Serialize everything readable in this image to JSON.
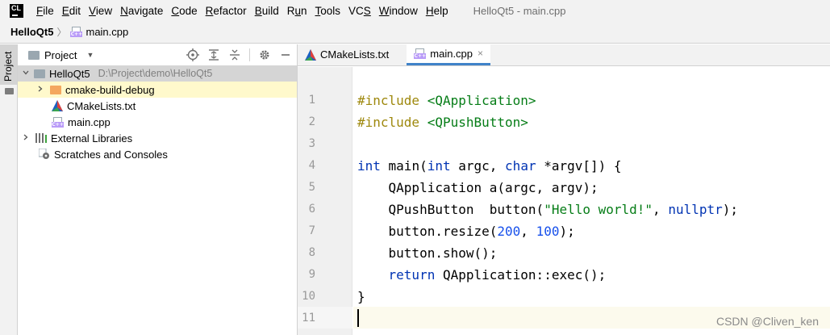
{
  "app": {
    "logo_text": "CL",
    "window_title": "HelloQt5 - main.cpp"
  },
  "menu": [
    {
      "pre": "",
      "ul": "F",
      "post": "ile"
    },
    {
      "pre": "",
      "ul": "E",
      "post": "dit"
    },
    {
      "pre": "",
      "ul": "V",
      "post": "iew"
    },
    {
      "pre": "",
      "ul": "N",
      "post": "avigate"
    },
    {
      "pre": "",
      "ul": "C",
      "post": "ode"
    },
    {
      "pre": "",
      "ul": "R",
      "post": "efactor"
    },
    {
      "pre": "",
      "ul": "B",
      "post": "uild"
    },
    {
      "pre": "R",
      "ul": "u",
      "post": "n"
    },
    {
      "pre": "",
      "ul": "T",
      "post": "ools"
    },
    {
      "pre": "VC",
      "ul": "S",
      "post": ""
    },
    {
      "pre": "",
      "ul": "W",
      "post": "indow"
    },
    {
      "pre": "",
      "ul": "H",
      "post": "elp"
    }
  ],
  "breadcrumb": {
    "project": "HelloQt5",
    "separator": "〉",
    "file": "main.cpp"
  },
  "toolstrip": {
    "project_tab": "Project"
  },
  "project_panel": {
    "title": "Project",
    "tools": {
      "locate": "target-icon",
      "expand": "expand-all-icon",
      "collapse": "collapse-all-icon",
      "settings": "gear-icon",
      "hide": "minimize-icon"
    },
    "tree": {
      "root": {
        "name": "HelloQt5",
        "path": "D:\\Project\\demo\\HelloQt5"
      },
      "build_dir": "cmake-build-debug",
      "cmakelists": "CMakeLists.txt",
      "main": "main.cpp",
      "external_libs": "External Libraries",
      "scratches": "Scratches and Consoles"
    }
  },
  "editor": {
    "tabs": [
      {
        "label": "CMakeLists.txt",
        "close": "×",
        "active": false
      },
      {
        "label": "main.cpp",
        "close": "×",
        "active": true
      }
    ],
    "line_numbers": [
      "1",
      "2",
      "3",
      "4",
      "5",
      "6",
      "7",
      "8",
      "9",
      "10",
      "11"
    ],
    "current_line": 11,
    "code": {
      "l1_kw": "#include",
      "l1_inc": " <QApplication>",
      "l2_kw": "#include",
      "l2_inc": " <QPushButton>",
      "l4_a": "int",
      "l4_b": " main(",
      "l4_c": "int",
      "l4_d": " argc, ",
      "l4_e": "char",
      "l4_f": " *argv[]) {",
      "l5": "    QApplication a(argc, argv);",
      "l6_a": "    QPushButton  button(",
      "l6_str": "\"Hello world!\"",
      "l6_b": ", ",
      "l6_kw": "nullptr",
      "l6_c": ");",
      "l7_a": "    button.resize(",
      "l7_n1": "200",
      "l7_b": ", ",
      "l7_n2": "100",
      "l7_c": ");",
      "l8": "    button.show();",
      "l9_kw": "    return",
      "l9_rest": " QApplication::exec();",
      "l10": "}"
    }
  },
  "watermark": "CSDN @Cliven_ken",
  "colors": {
    "keyword": "#0033b3",
    "preprocessor": "#9e880d",
    "string": "#067d17",
    "number": "#1750eb",
    "tab_accent": "#4083c9"
  }
}
